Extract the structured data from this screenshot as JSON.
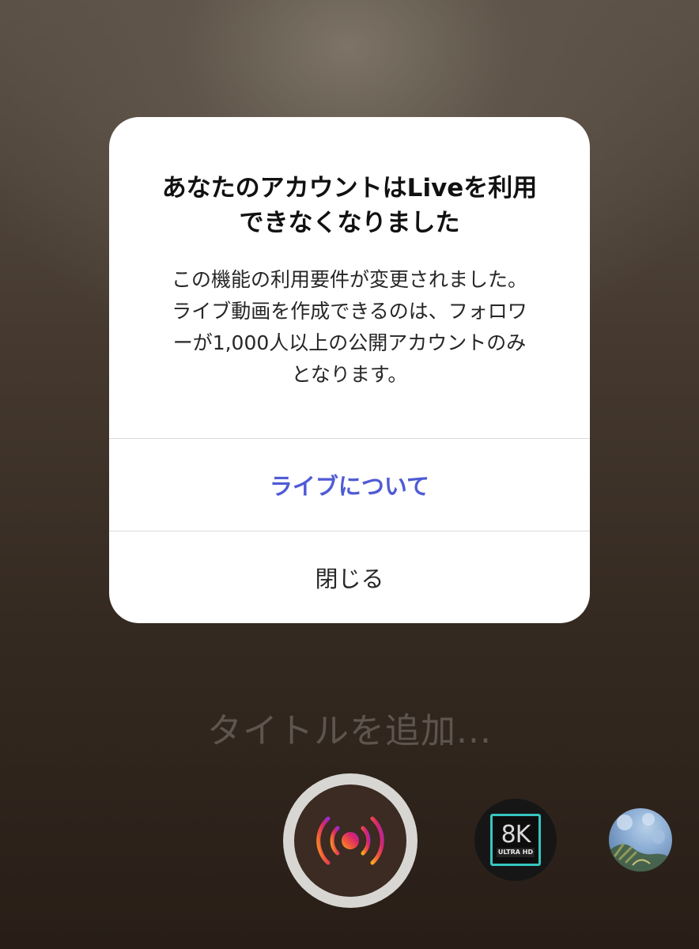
{
  "dialog": {
    "title": "あなたのアカウントはLiveを利用\nできなくなりました",
    "body": "この機能の利用要件が変更されました。\nライブ動画を作成できるのは、フォロワ\nーが1,000人以上の公開アカウントのみ\nとなります。",
    "primary_label": "ライブについて",
    "close_label": "閉じる"
  },
  "camera": {
    "title_placeholder": "タイトルを追加..."
  },
  "effects": [
    {
      "badge_text": "8K",
      "badge_subtext": "ULTRA HD"
    }
  ],
  "colors": {
    "accent": "#4f5bd5",
    "dialog_bg": "#ffffff"
  },
  "icons": [
    "live-broadcast-icon",
    "8k-ultra-hd-effect-icon",
    "photo-effect-thumbnail"
  ]
}
